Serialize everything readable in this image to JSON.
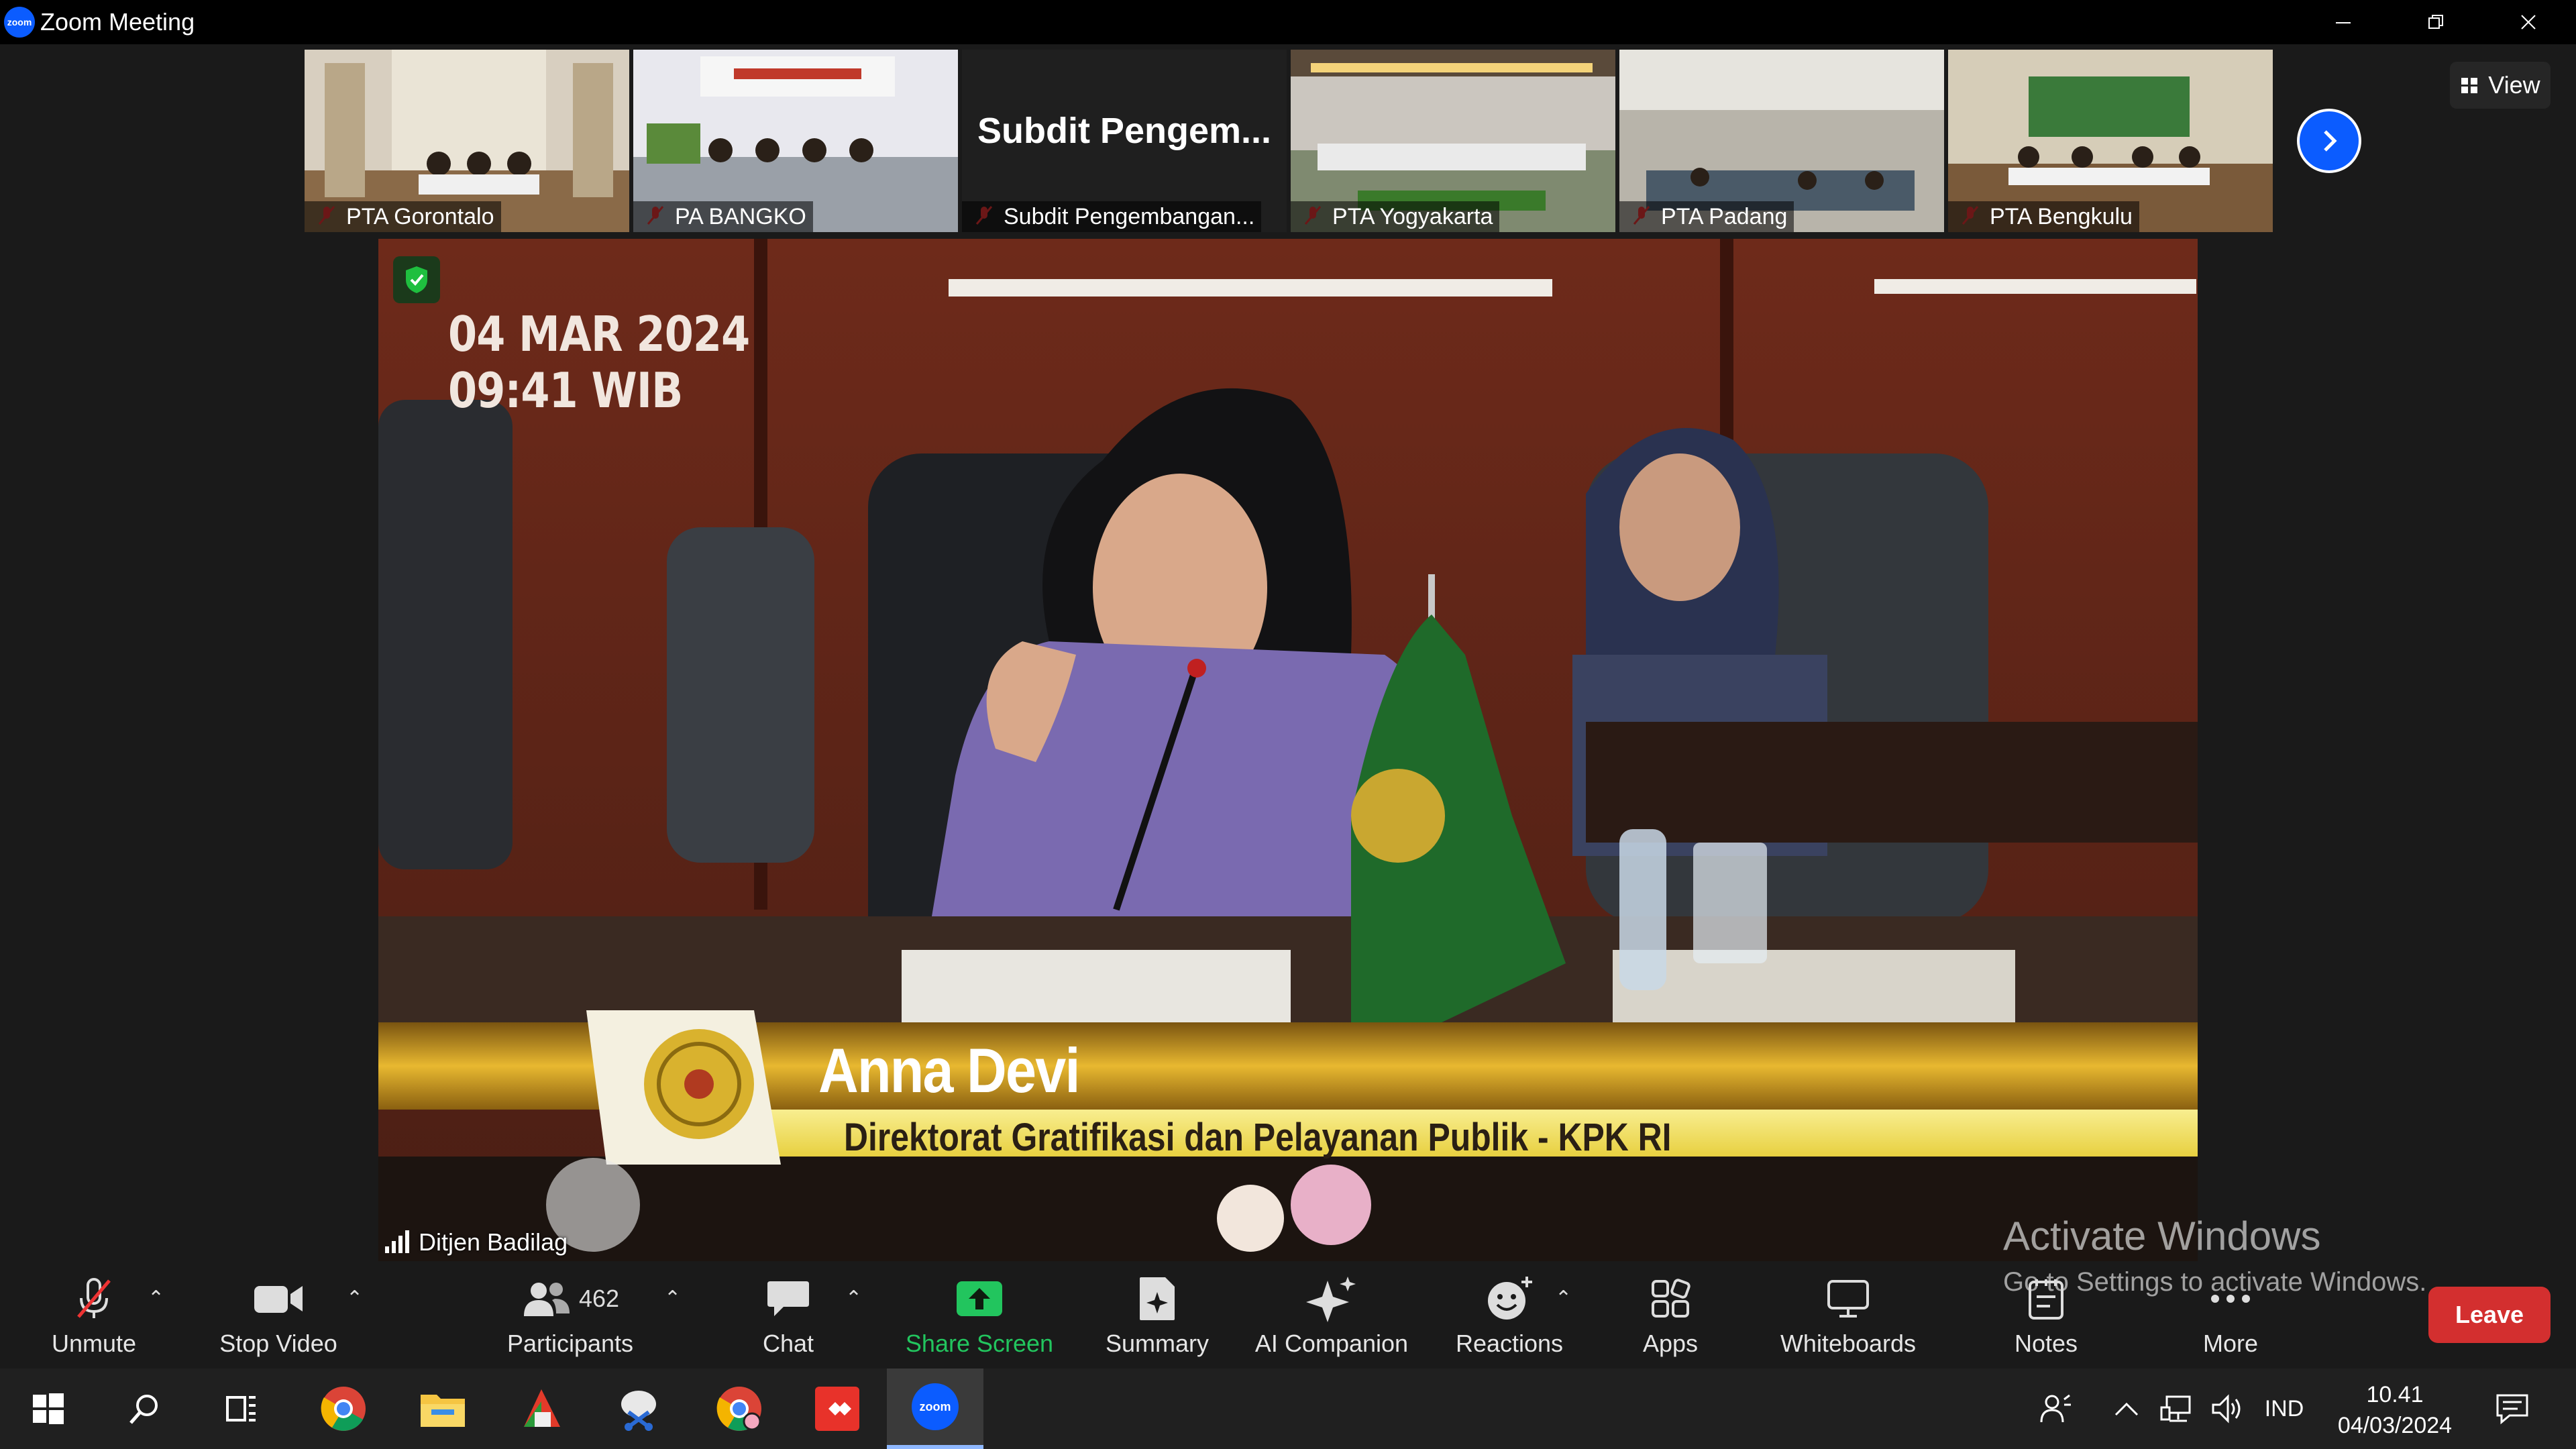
{
  "window": {
    "app_icon_text": "zoom",
    "title": "Zoom Meeting"
  },
  "thumbnails": [
    {
      "name": "PTA Gorontalo",
      "muted": true
    },
    {
      "name": "PA BANGKO",
      "muted": true
    },
    {
      "name": "Subdit Pengembangan...",
      "display_text": "Subdit  Pengem...",
      "muted": true
    },
    {
      "name": "PTA Yogyakarta",
      "muted": true
    },
    {
      "name": "PTA Padang",
      "muted": true
    },
    {
      "name": "PTA Bengkulu",
      "muted": true
    }
  ],
  "view_button": {
    "label": "View"
  },
  "main_video": {
    "date": "04 MAR 2024",
    "time": "09:41 WIB",
    "speaker_name": "Anna Devi",
    "speaker_title": "Direktorat Gratifikasi dan Pelayanan Publik - KPK RI",
    "participant_label": "Ditjen Badilag"
  },
  "watermark": {
    "line1": "Activate Windows",
    "line2": "Go to Settings to activate Windows."
  },
  "toolbar": {
    "unmute": "Unmute",
    "stop_video": "Stop Video",
    "participants": "Participants",
    "participants_count": "462",
    "chat": "Chat",
    "share_screen": "Share Screen",
    "summary": "Summary",
    "ai_companion": "AI Companion",
    "reactions": "Reactions",
    "apps": "Apps",
    "whiteboards": "Whiteboards",
    "notes": "Notes",
    "more": "More",
    "leave": "Leave"
  },
  "taskbar": {
    "language": "IND",
    "time": "10.41",
    "date": "04/03/2024",
    "zoom_icon_text": "zoom"
  },
  "colors": {
    "accent": "#0b5cff",
    "share_green": "#22c55e",
    "leave_red": "#d32f2f"
  }
}
